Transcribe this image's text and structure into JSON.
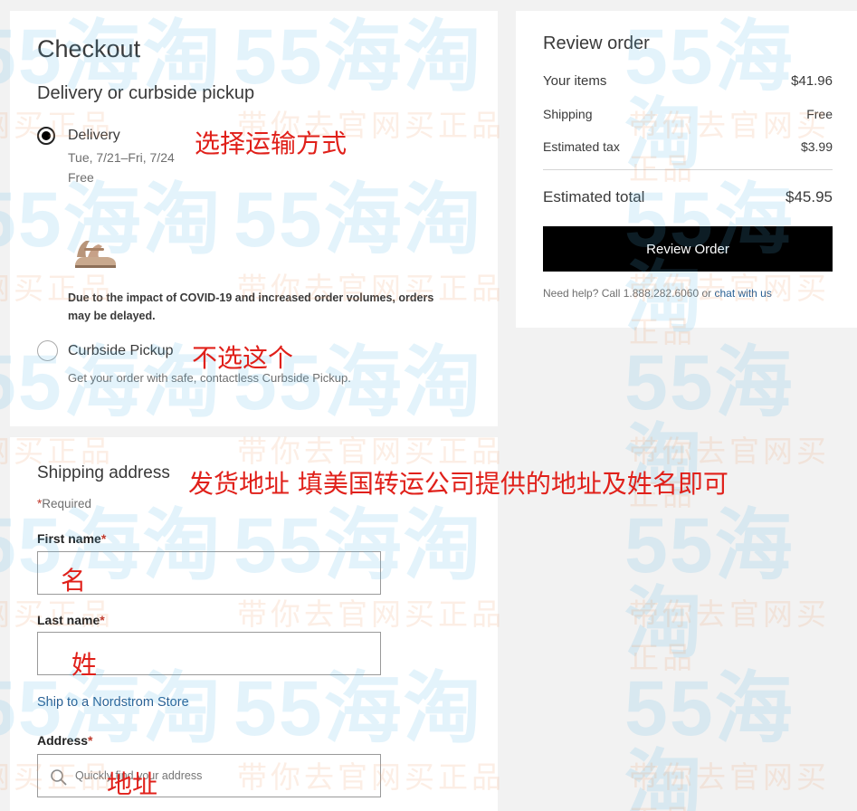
{
  "checkout": {
    "title": "Checkout",
    "section_title": "Delivery or curbside pickup",
    "delivery": {
      "label": "Delivery",
      "dates": "Tue, 7/21–Fri, 7/24",
      "price": "Free",
      "selected": true
    },
    "notice": "Due to the impact of COVID-19 and increased order volumes, orders may be delayed.",
    "curbside": {
      "label": "Curbside Pickup",
      "description": "Get your order with safe, contactless Curbside Pickup.",
      "selected": false
    }
  },
  "review": {
    "title": "Review order",
    "rows": [
      {
        "label": "Your items",
        "value": "$41.96"
      },
      {
        "label": "Shipping",
        "value": "Free"
      },
      {
        "label": "Estimated tax",
        "value": "$3.99"
      }
    ],
    "total_label": "Estimated total",
    "total_value": "$45.95",
    "button_label": "Review Order",
    "help_prefix": "Need help? Call 1.888.282.6060 or ",
    "help_link": "chat with us"
  },
  "shipping": {
    "title": "Shipping address",
    "required_note": "Required",
    "first_name_label": "First name",
    "last_name_label": "Last name",
    "store_link": "Ship to a Nordstrom Store",
    "address_label": "Address",
    "address_placeholder": "Quickly find your address"
  },
  "annotations": {
    "delivery": "选择运输方式",
    "curbside": "不选这个",
    "shipping": "发货地址  填美国转运公司提供的地址及姓名即可",
    "first_name": "名",
    "last_name": "姓",
    "address": "地址"
  },
  "watermark": {
    "number": "55海淘",
    "tagline": "带你去官网买正品"
  },
  "colors": {
    "accent_red": "#e0201a",
    "link_blue": "#285f93",
    "button_black": "#000000"
  },
  "icons": [
    "radio-selected-icon",
    "radio-unselected-icon",
    "search-icon",
    "sandal-product-image"
  ]
}
